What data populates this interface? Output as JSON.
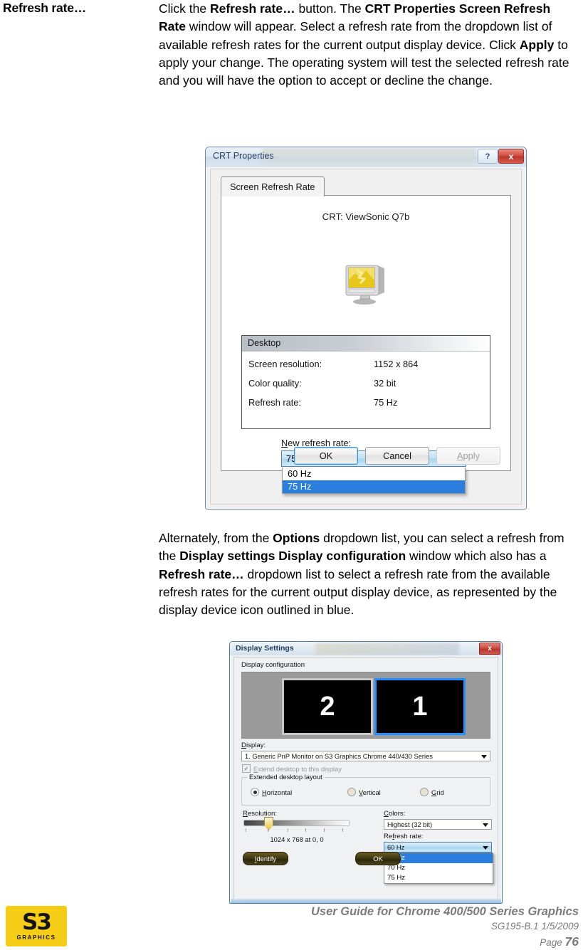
{
  "document": {
    "term_label": "Refresh rate…",
    "paragraph1_parts": [
      {
        "t": "Click the ",
        "b": false
      },
      {
        "t": "Refresh rate…",
        "b": true
      },
      {
        "t": " button. The ",
        "b": false
      },
      {
        "t": "CRT Properties Screen Refresh Rate",
        "b": true
      },
      {
        "t": " window will appear. Select a refresh rate from the dropdown list of available refresh rates for the current output display device. Click ",
        "b": false
      },
      {
        "t": "Apply",
        "b": true
      },
      {
        "t": " to apply your change. The operating system will test the selected refresh rate and you will have the option to accept or decline the change.",
        "b": false
      }
    ],
    "paragraph2_parts": [
      {
        "t": "Alternately, from the ",
        "b": false
      },
      {
        "t": "Options",
        "b": true
      },
      {
        "t": " dropdown list, you can select a refresh from the ",
        "b": false
      },
      {
        "t": "Display settings Display configuration",
        "b": true
      },
      {
        "t": " window which also has a ",
        "b": false
      },
      {
        "t": "Refresh rate…",
        "b": true
      },
      {
        "t": " dropdown list to select a refresh rate from the available refresh rates for the current output display device, as represented by the display device icon outlined in blue.",
        "b": false
      }
    ]
  },
  "crt_dialog": {
    "title": "CRT Properties",
    "help_button": "?",
    "close_button": "x",
    "tab": "Screen Refresh Rate",
    "device_title": "CRT: ViewSonic Q7b",
    "desktop_group": {
      "header": "Desktop",
      "rows": [
        {
          "key": "Screen resolution:",
          "value": "1152 x 864"
        },
        {
          "key": "Color quality:",
          "value": "32 bit"
        },
        {
          "key": "Refresh rate:",
          "value": "75 Hz"
        }
      ]
    },
    "new_refresh_rate": {
      "label_underlined": "N",
      "label_rest": "ew refresh rate:",
      "selected": "75 Hz",
      "options": [
        "60 Hz",
        "75 Hz"
      ],
      "highlighted": "75 Hz"
    },
    "buttons": {
      "ok": "OK",
      "cancel": "Cancel",
      "apply_underlined": "A",
      "apply_rest": "pply"
    }
  },
  "display_settings_dialog": {
    "title": "Display Settings",
    "close_button": "x",
    "display_configuration_label": "Display configuration",
    "monitors": [
      {
        "number": "2",
        "selected": false
      },
      {
        "number": "1",
        "selected": true
      }
    ],
    "display_label_underlined": "D",
    "display_label_rest": "isplay:",
    "display_value": "1. Generic PnP Monitor on S3 Graphics Chrome 440/430 Series",
    "extend_checkbox": {
      "checked": true,
      "label_underlined": "E",
      "label_rest": "xtend desktop to this display"
    },
    "extended_desktop_layout": {
      "legend": "Extended desktop layout",
      "options": [
        {
          "label_underlined": "H",
          "label_rest": "orizontal",
          "selected": true
        },
        {
          "label_underlined": "V",
          "label_rest": "ertical",
          "selected": false
        },
        {
          "label_underlined": "G",
          "label_rest": "rid",
          "selected": false
        }
      ]
    },
    "resolution": {
      "label_underlined": "R",
      "label_rest": "esolution:",
      "value_text": "1024 x 768 at 0, 0",
      "slider_position_percent": 22,
      "tick_count": 6
    },
    "colors": {
      "label_underlined": "C",
      "label_rest": "olors:",
      "value": "Highest (32 bit)"
    },
    "refresh_rate": {
      "label_pre": "Re",
      "label_underlined": "f",
      "label_rest": "resh rate:",
      "selected": "60 Hz",
      "options": [
        "60 Hz",
        "70 Hz",
        "75 Hz"
      ],
      "highlighted": "60 Hz"
    },
    "buttons": {
      "identify_underlined": "I",
      "identify_rest": "dentify",
      "ok": "OK"
    }
  },
  "footer": {
    "logo_main": "S3",
    "logo_sub": "GRAPHICS",
    "guide_title": "User Guide for Chrome 400/500 Series Graphics",
    "doc_id": "SG195-B.1   1/5/2009",
    "page_word": "Page ",
    "page_number": "76"
  },
  "colors": {
    "accent_blue": "#2a7fde",
    "selected_monitor_outline": "#1e90ff",
    "logo_yellow": "#f5cd16",
    "footer_gray": "#7b7b7b",
    "close_red": "#c8463a"
  }
}
